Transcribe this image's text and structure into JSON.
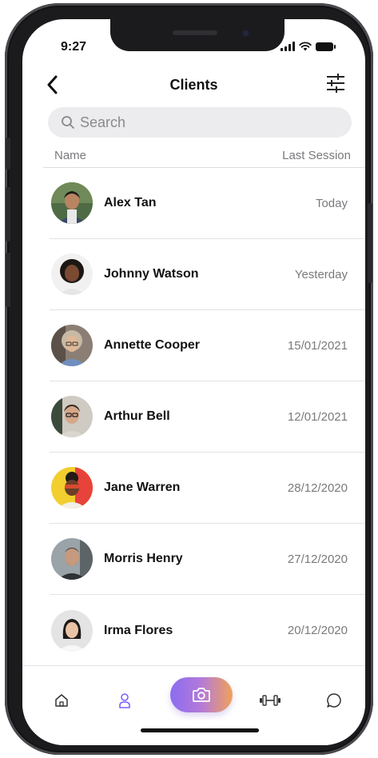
{
  "status_bar": {
    "time": "9:27"
  },
  "header": {
    "title": "Clients"
  },
  "search": {
    "placeholder": "Search"
  },
  "columns": {
    "name": "Name",
    "last_session": "Last Session"
  },
  "clients": [
    {
      "name": "Alex Tan",
      "last_session": "Today"
    },
    {
      "name": "Johnny Watson",
      "last_session": "Yesterday"
    },
    {
      "name": "Annette Cooper",
      "last_session": "15/01/2021"
    },
    {
      "name": "Arthur Bell",
      "last_session": "12/01/2021"
    },
    {
      "name": "Jane Warren",
      "last_session": "28/12/2020"
    },
    {
      "name": "Morris Henry",
      "last_session": "27/12/2020"
    },
    {
      "name": "Irma Flores",
      "last_session": "20/12/2020"
    }
  ],
  "tab_bar": {
    "items": [
      "home-icon",
      "user-icon",
      "camera-icon",
      "dumbbell-icon",
      "chat-icon"
    ],
    "active": "user-icon"
  },
  "colors": {
    "accent": "#7b61ff",
    "camera_gradient": [
      "#8b6cf0",
      "#f0a25a"
    ],
    "text_primary": "#111111",
    "text_secondary": "#7a7a7e"
  }
}
